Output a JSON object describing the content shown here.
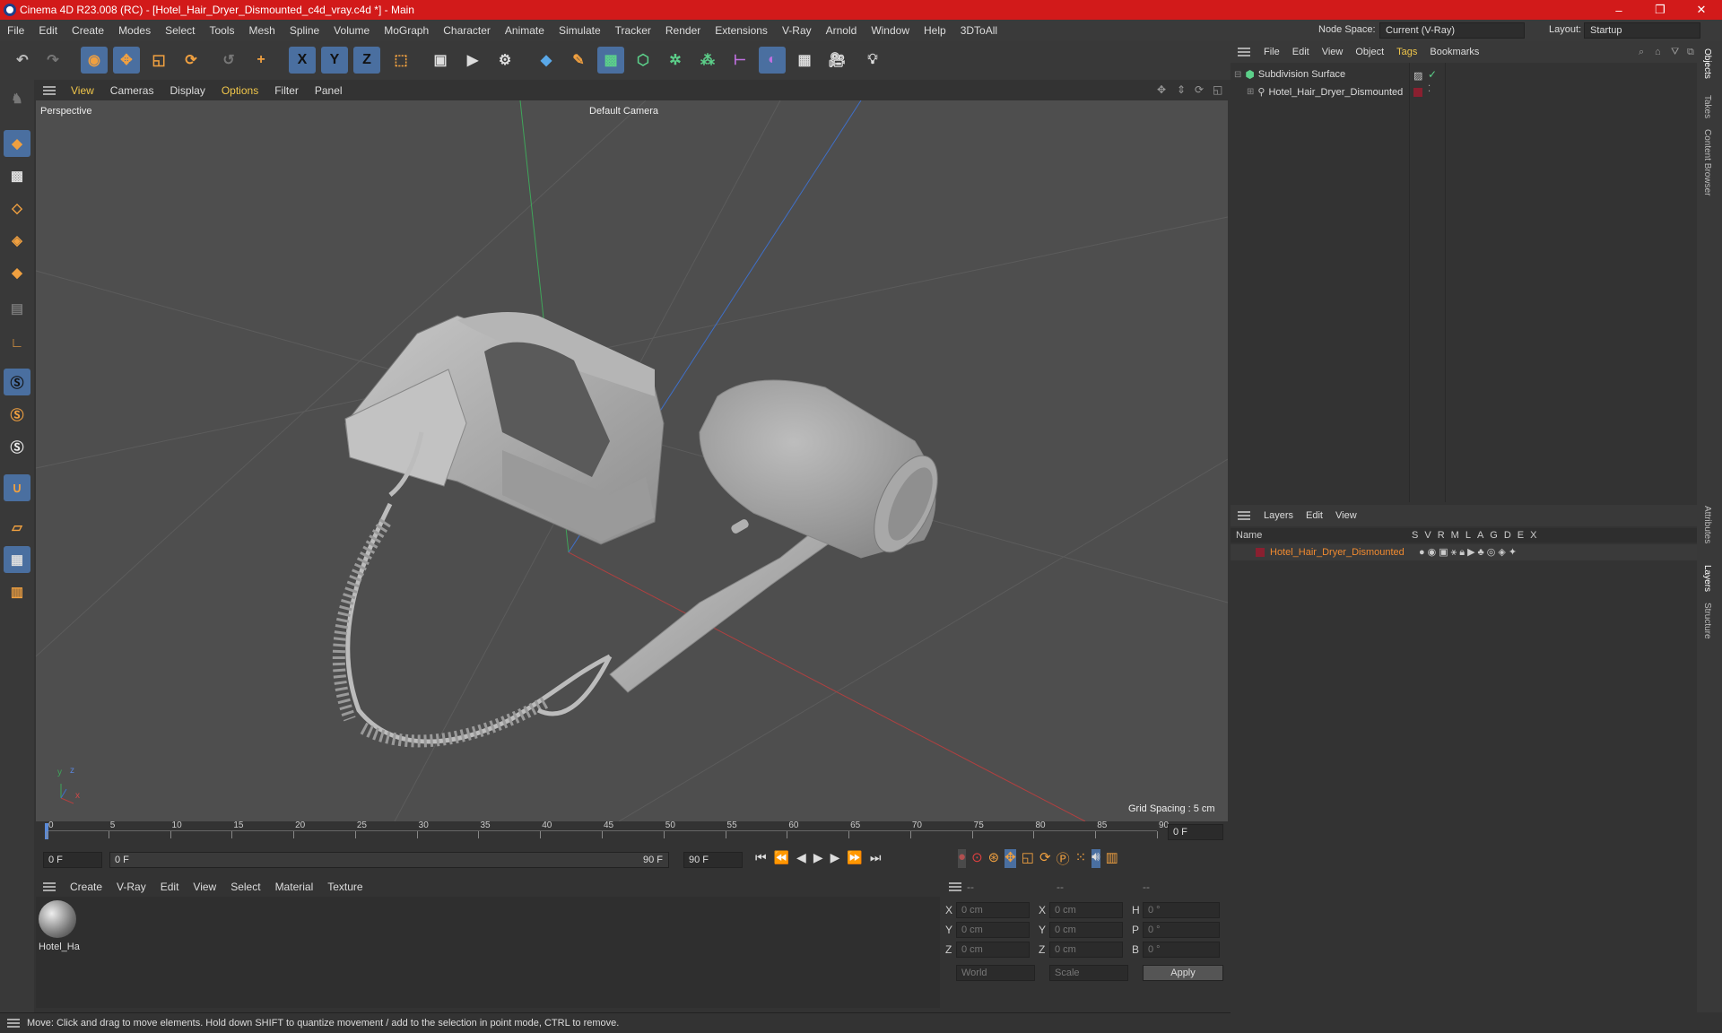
{
  "window": {
    "title": "Cinema 4D R23.008 (RC) - [Hotel_Hair_Dryer_Dismounted_c4d_vray.c4d *] - Main",
    "minimize": "–",
    "restore": "❐",
    "close": "✕"
  },
  "menu": [
    "File",
    "Edit",
    "Create",
    "Modes",
    "Select",
    "Tools",
    "Mesh",
    "Spline",
    "Volume",
    "MoGraph",
    "Character",
    "Animate",
    "Simulate",
    "Tracker",
    "Render",
    "Extensions",
    "V-Ray",
    "Arnold",
    "Window",
    "Help",
    "3DToAll"
  ],
  "node_space": {
    "label": "Node Space:",
    "value": "Current (V-Ray)"
  },
  "layout": {
    "label": "Layout:",
    "value": "Startup"
  },
  "toolbar_icons": [
    "undo-icon",
    "redo-icon",
    "live-selection-icon",
    "move-icon",
    "scale-icon",
    "rotate-icon",
    "recent-tool-icon",
    "add-tool-icon",
    "x-axis-icon",
    "y-axis-icon",
    "z-axis-icon",
    "coordinate-system-icon",
    "render-region-icon",
    "render-view-icon",
    "render-settings-icon",
    "cube-icon",
    "pen-icon",
    "subdivision-icon",
    "extrude-icon",
    "cloner-icon",
    "array-icon",
    "deformer-icon",
    "field-icon",
    "floor-icon",
    "camera-icon",
    "light-icon"
  ],
  "toolbar_glyphs": {
    "x": "X",
    "y": "Y",
    "z": "Z"
  },
  "viewport": {
    "menu": [
      "View",
      "Cameras",
      "Display",
      "Options",
      "Filter",
      "Panel"
    ],
    "name": "Perspective",
    "camera": "Default Camera",
    "grid_spacing": "Grid Spacing : 5 cm",
    "axis_x": "x",
    "axis_y": "y",
    "axis_z": "z"
  },
  "timeline": {
    "ticks": [
      "0",
      "5",
      "10",
      "15",
      "20",
      "25",
      "30",
      "35",
      "40",
      "45",
      "50",
      "55",
      "60",
      "65",
      "70",
      "75",
      "80",
      "85",
      "90"
    ],
    "current_frame": "0 F"
  },
  "playback": {
    "start": "0 F",
    "range_start": "0 F",
    "range_end": "90 F",
    "end": "90 F"
  },
  "material_menu": [
    "Create",
    "V-Ray",
    "Edit",
    "View",
    "Select",
    "Material",
    "Texture"
  ],
  "material": {
    "name": "Hotel_Ha"
  },
  "coords": {
    "headers": [
      "--",
      "--",
      "--"
    ],
    "x1": "0 cm",
    "y1": "0 cm",
    "z1": "0 cm",
    "x2": "0 cm",
    "y2": "0 cm",
    "z2": "0 cm",
    "h": "0 °",
    "p": "0 °",
    "b": "0 °",
    "lx": "X",
    "ly": "Y",
    "lz": "Z",
    "lx2": "X",
    "ly2": "Y",
    "lz2": "Z",
    "lh": "H",
    "lp": "P",
    "lb": "B",
    "world": "World",
    "scale": "Scale",
    "apply": "Apply"
  },
  "status": "Move: Click and drag to move elements. Hold down SHIFT to quantize movement / add to the selection in point mode, CTRL to remove.",
  "objects": {
    "menu": [
      "File",
      "Edit",
      "View",
      "Object",
      "Tags",
      "Bookmarks"
    ],
    "items": [
      "Subdivision Surface",
      "Hotel_Hair_Dryer_Dismounted"
    ]
  },
  "layers": {
    "menu": [
      "Layers",
      "Edit",
      "View"
    ],
    "col_name": "Name",
    "cols": [
      "S",
      "V",
      "R",
      "M",
      "L",
      "A",
      "G",
      "D",
      "E",
      "X"
    ],
    "item": "Hotel_Hair_Dryer_Dismounted"
  },
  "right_tabs": [
    "Objects",
    "Takes",
    "Content Browser",
    "Attributes",
    "Layers",
    "Structure"
  ],
  "colors": {
    "accent": "#f0c64a",
    "title_bar": "#d21a1a",
    "layer_color": "#8a2030",
    "selected": "#4a6fa0"
  }
}
